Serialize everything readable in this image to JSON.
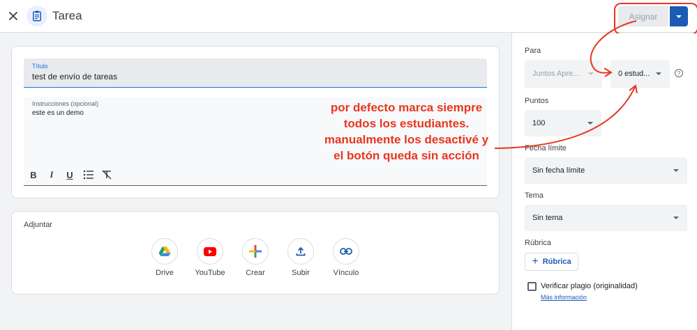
{
  "header": {
    "title": "Tarea",
    "assign_label": "Asignar"
  },
  "form": {
    "title_label": "Título",
    "title_value": "test de envío de tareas",
    "instructions_label": "Instrucciones (opcional)",
    "instructions_value": "este es un demo",
    "formatting": [
      "B",
      "I",
      "U",
      "list",
      "clear-format"
    ]
  },
  "attach": {
    "title": "Adjuntar",
    "items": [
      {
        "label": "Drive",
        "icon": "google-drive-icon"
      },
      {
        "label": "YouTube",
        "icon": "youtube-icon"
      },
      {
        "label": "Crear",
        "icon": "create-plus-icon"
      },
      {
        "label": "Subir",
        "icon": "upload-icon"
      },
      {
        "label": "Vínculo",
        "icon": "link-icon"
      }
    ]
  },
  "annotation": {
    "lines": [
      "por defecto marca siempre",
      "todos los estudiantes.",
      "manualmente los desactivé y",
      "el botón queda sin acción"
    ],
    "color": "#e8361f"
  },
  "sidebar": {
    "for_label": "Para",
    "class_value": "Juntos Apre...",
    "students_value": "0 estud...",
    "help_glyph": "?",
    "points_label": "Puntos",
    "points_value": "100",
    "due_label": "Fecha límite",
    "due_value": "Sin fecha límite",
    "topic_label": "Tema",
    "topic_value": "Sin tema",
    "rubric_label": "Rúbrica",
    "rubric_button": "Rúbrica",
    "plagiarism_label": "Verificar plagio (originalidad)",
    "more_info": "Más información"
  },
  "colors": {
    "accent": "#1a5bb5",
    "annotation": "#e8361f"
  }
}
